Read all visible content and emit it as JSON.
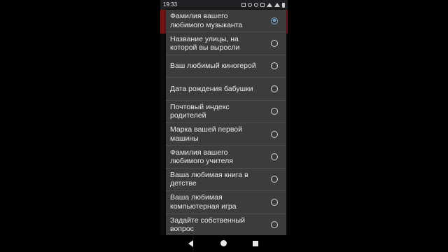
{
  "status_bar": {
    "time": "19:33",
    "icons": [
      "gmail-icon",
      "alarm-icon",
      "minus-icon",
      "vibrate-icon",
      "wifi-icon",
      "signal-icon",
      "battery-icon"
    ]
  },
  "dialog": {
    "options": [
      {
        "label": "Фамилия вашего любимого музыканта",
        "selected": true
      },
      {
        "label": "Название улицы, на которой вы выросли",
        "selected": false
      },
      {
        "label": "Ваш любимый киногерой",
        "selected": false
      },
      {
        "label": "Дата рождения бабушки",
        "selected": false
      },
      {
        "label": "Почтовый индекс родителей",
        "selected": false
      },
      {
        "label": "Марка вашей первой машины",
        "selected": false
      },
      {
        "label": "Фамилия вашего любимого учителя",
        "selected": false
      },
      {
        "label": "Ваша любимая книга в детстве",
        "selected": false
      },
      {
        "label": "Ваша любимая компьютерная игра",
        "selected": false
      },
      {
        "label": "Задайте собственный вопрос",
        "selected": false
      }
    ]
  },
  "colors": {
    "dialog_bg": "#3c3c3c",
    "accent": "#80a8d8",
    "backdrop_strip": "#7a1616"
  }
}
